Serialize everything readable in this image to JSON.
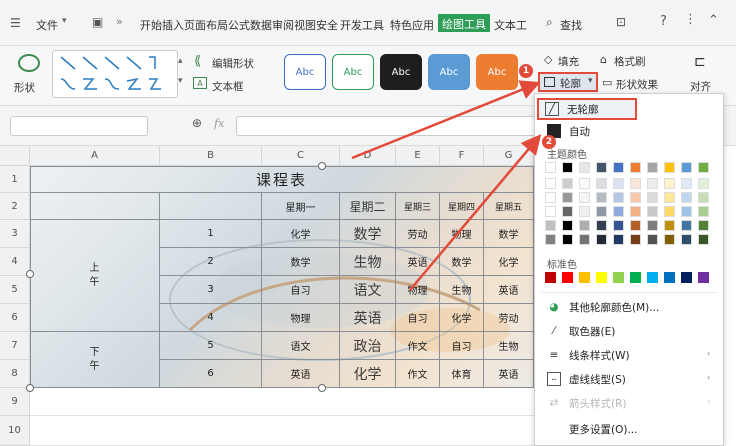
{
  "menubar": {
    "file_label": "文件",
    "tabs": [
      "开始",
      "插入",
      "页面布局",
      "公式",
      "数据",
      "审阅",
      "视图",
      "安全",
      "开发工具",
      "特色应用"
    ],
    "active_tab": "绘图工具",
    "text_tab": "文本工",
    "search_label": "查找"
  },
  "ribbon": {
    "shape_label": "形状",
    "edit_shape_label": "编辑形状",
    "textbox_label": "文本框",
    "style_presets": [
      "Abc",
      "Abc",
      "Abc",
      "Abc",
      "Abc"
    ],
    "fill_label": "填充",
    "format_brush_label": "格式刷",
    "outline_label": "轮廓",
    "shape_effect_label": "形状效果",
    "align_label": "对齐"
  },
  "formula_bar": {
    "fx_label": "fx"
  },
  "columns": [
    "A",
    "B",
    "C",
    "D",
    "E",
    "F",
    "G"
  ],
  "rows": [
    "1",
    "2",
    "3",
    "4",
    "5",
    "6",
    "7",
    "8",
    "9",
    "10"
  ],
  "table": {
    "title": "课程表",
    "days": [
      "星期一",
      "星期二",
      "星期三",
      "星期四",
      "星期五"
    ],
    "period_nums": [
      "1",
      "2",
      "3",
      "4",
      "5",
      "6"
    ],
    "morning": "上\n午",
    "afternoon": "下\n午",
    "courses": [
      [
        "化学",
        "数学",
        "劳动",
        "物理",
        "数学"
      ],
      [
        "数学",
        "生物",
        "英语",
        "数学",
        "化学"
      ],
      [
        "自习",
        "语文",
        "物理",
        "生物",
        "英语"
      ],
      [
        "物理",
        "英语",
        "自习",
        "化学",
        "劳动"
      ],
      [
        "语文",
        "政治",
        "作文",
        "自习",
        "生物"
      ],
      [
        "英语",
        "化学",
        "作文",
        "体育",
        "英语"
      ]
    ]
  },
  "dropdown": {
    "no_outline": "无轮廓",
    "auto": "自动",
    "theme_colors": "主题颜色",
    "standard_colors": "标准色",
    "more_colors": "其他轮廓颜色(M)...",
    "eyedropper": "取色器(E)",
    "line_style": "线条样式(W)",
    "dash_style": "虚线线型(S)",
    "arrow_style": "箭头样式(R)",
    "more_settings": "更多设置(O)..."
  },
  "badges": [
    "1",
    "2"
  ],
  "colors": {
    "accent": "#2e9e57",
    "highlight": "#e24a3a",
    "standard": [
      "#c00000",
      "#ff0000",
      "#ffc000",
      "#ffff00",
      "#92d050",
      "#00b050",
      "#00b0f0",
      "#0070c0",
      "#002060",
      "#7030a0"
    ]
  }
}
